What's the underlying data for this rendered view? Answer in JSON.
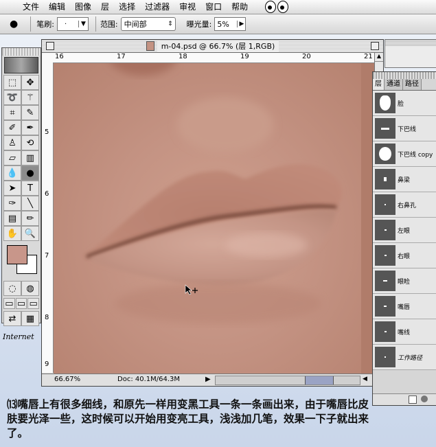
{
  "menubar": {
    "items": [
      "文件",
      "编辑",
      "图像",
      "层",
      "选择",
      "过滤器",
      "审视",
      "窗口",
      "帮助"
    ]
  },
  "options": {
    "brush_label": "笔刷:",
    "range_label": "范围:",
    "range_value": "中间部",
    "exposure_label": "曝光量:",
    "exposure_value": "5%"
  },
  "document": {
    "title": "m-04.psd @ 66.7% (层 1,RGB)",
    "ruler_top": [
      "16",
      "17",
      "18",
      "19",
      "20",
      "21"
    ],
    "ruler_left": [
      "5",
      "6",
      "7",
      "8",
      "9"
    ],
    "zoom": "66.67%",
    "doc_size": "Doc: 40.1M/64.3M"
  },
  "layers_panel": {
    "tabs": [
      "层",
      "通道",
      "路径"
    ],
    "items": [
      "脸",
      "下巴线",
      "下巴线 copy",
      "鼻梁",
      "右鼻孔",
      "左眼",
      "右眼",
      "眼睑",
      "嘴唇",
      "嘴线",
      "工作路径"
    ]
  },
  "desktop": {
    "internet_label": "Internet"
  },
  "caption": {
    "text": "⒀嘴唇上有很多细线，和原先一样用变黑工具一条一条画出来，由于嘴唇比皮肤要光泽一些，这时候可以开始用变亮工具，浅浅加几笔，效果一下子就出来了。"
  },
  "colors": {
    "foreground": "#c8968a",
    "background": "#ffffff",
    "skin": "#c49383"
  }
}
